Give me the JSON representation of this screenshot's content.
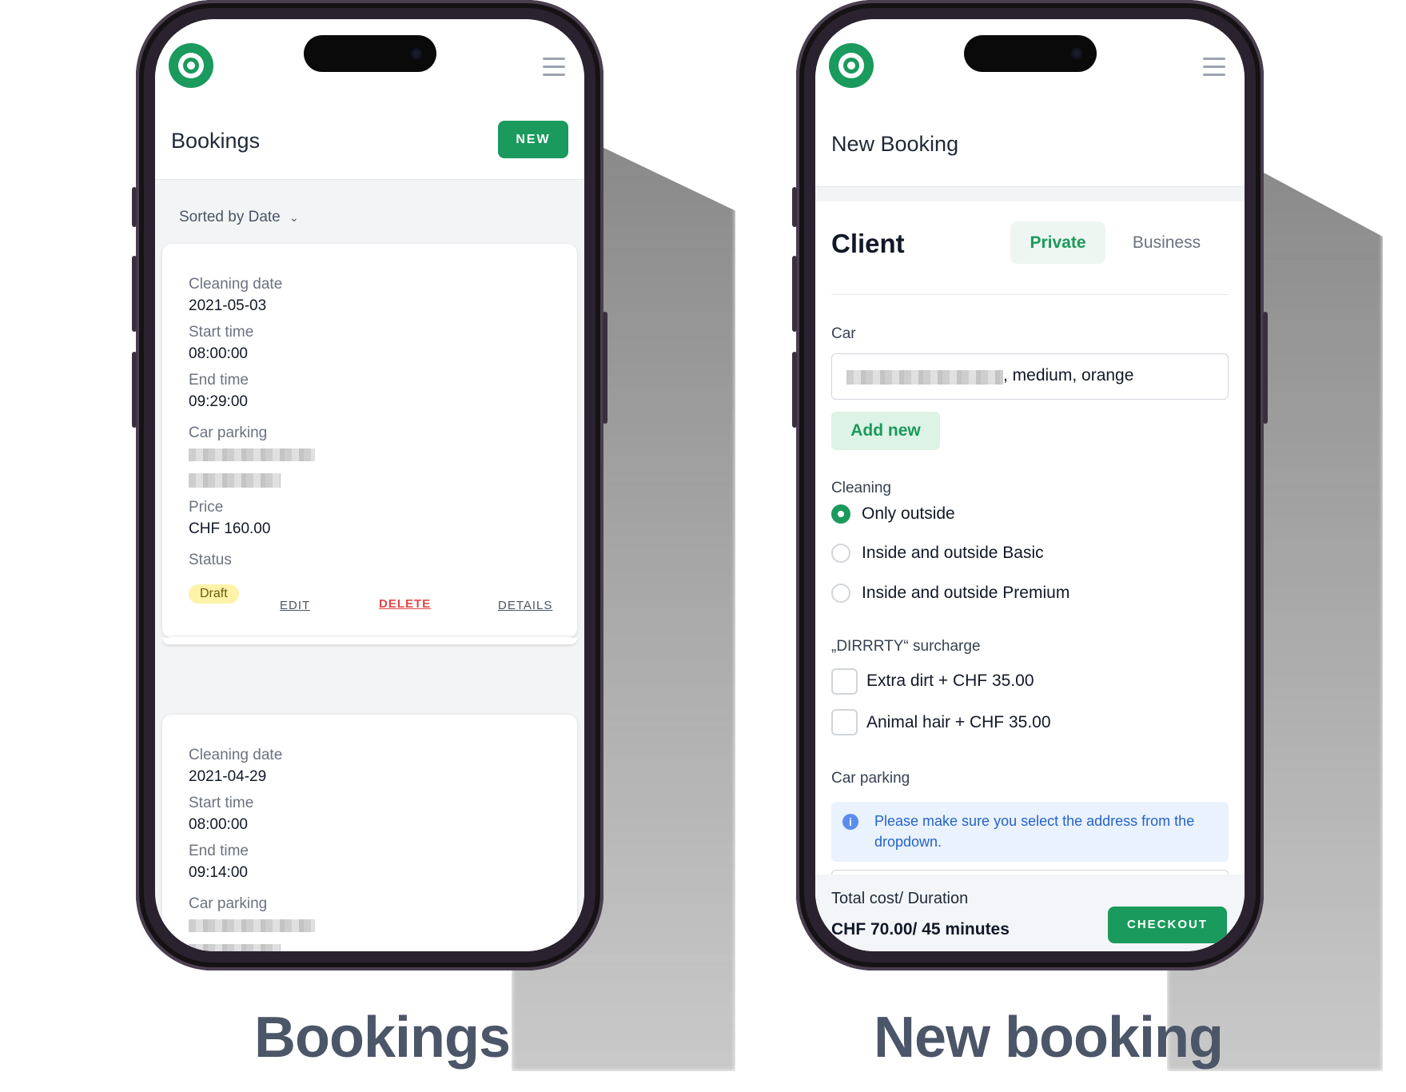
{
  "captions": {
    "left": "Bookings",
    "right": "New booking"
  },
  "bookings_screen": {
    "title": "Bookings",
    "new_button": "NEW",
    "sort_label": "Sorted by Date",
    "cards": [
      {
        "cleaning_date_label": "Cleaning date",
        "cleaning_date": "2021-05-03",
        "start_time_label": "Start time",
        "start_time": "08:00:00",
        "end_time_label": "End time",
        "end_time": "09:29:00",
        "car_parking_label": "Car parking",
        "price_label": "Price",
        "price": "CHF 160.00",
        "status_label": "Status",
        "status": "Draft",
        "actions": {
          "edit": "EDIT",
          "delete": "DELETE",
          "details": "DETAILS"
        }
      },
      {
        "cleaning_date_label": "Cleaning date",
        "cleaning_date": "2021-04-29",
        "start_time_label": "Start time",
        "start_time": "08:00:00",
        "end_time_label": "End time",
        "end_time": "09:14:00",
        "car_parking_label": "Car parking"
      }
    ]
  },
  "new_booking_screen": {
    "title": "New Booking",
    "client_heading": "Client",
    "client_tabs": [
      "Private",
      "Business"
    ],
    "car_label": "Car",
    "car_value_suffix": ", medium, orange",
    "add_new_button": "Add new",
    "cleaning_label": "Cleaning",
    "cleaning_options": [
      "Only outside",
      "Inside and outside Basic",
      "Inside and outside Premium"
    ],
    "cleaning_selected": "Only outside",
    "surcharge_label": "„DIRRRTY“ surcharge",
    "surcharge_options": [
      "Extra dirt + CHF 35.00",
      "Animal hair + CHF 35.00"
    ],
    "car_parking_label": "Car parking",
    "info_message": "Please make sure you select the address from the dropdown.",
    "total_label": "Total cost/ Duration",
    "total_value": "CHF 70.00/ 45 minutes",
    "checkout_button": "CHECKOUT"
  },
  "colors": {
    "accent": "#1a9a5c",
    "danger": "#e04848",
    "badge_bg": "#fef3a8",
    "info_bg": "#eaf2fd",
    "info_text": "#2563c9"
  }
}
